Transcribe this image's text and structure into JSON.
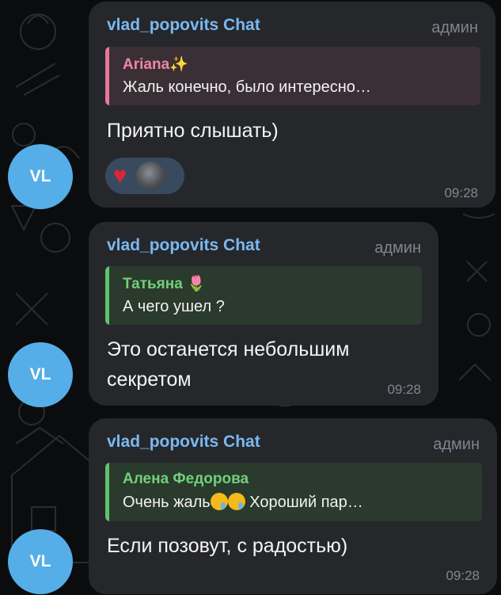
{
  "avatar_initials": "VL",
  "messages": [
    {
      "sender": "vlad_popovits Chat",
      "role": "админ",
      "reply_name": "Ariana✨",
      "reply_text": "Жаль конечно, было интересно…",
      "text": "Приятно слышать)",
      "reaction_icon": "heart-icon",
      "time": "09:28"
    },
    {
      "sender": "vlad_popovits Chat",
      "role": "админ",
      "reply_name": "Татьяна 🌷",
      "reply_text": "А чего ушел ?",
      "text_line1": "Это останется небольшим",
      "text_line2": "секретом",
      "time": "09:28"
    },
    {
      "sender": "vlad_popovits Chat",
      "role": "админ",
      "reply_name": "Алена Федорова",
      "reply_text_before": "Очень жаль",
      "reply_text_after": " Хороший пар…",
      "reply_emojis": [
        "sad-face-icon",
        "crying-face-icon"
      ],
      "text": "Если позовут, с радостью)",
      "time": "09:28"
    }
  ],
  "colors": {
    "sender": "#7bb8f0",
    "reply1_accent": "#e8779a",
    "reply2_accent": "#5fc36a",
    "reply3_accent": "#5fc36a",
    "bubble": "#25272b",
    "avatar": "#55aee8"
  }
}
